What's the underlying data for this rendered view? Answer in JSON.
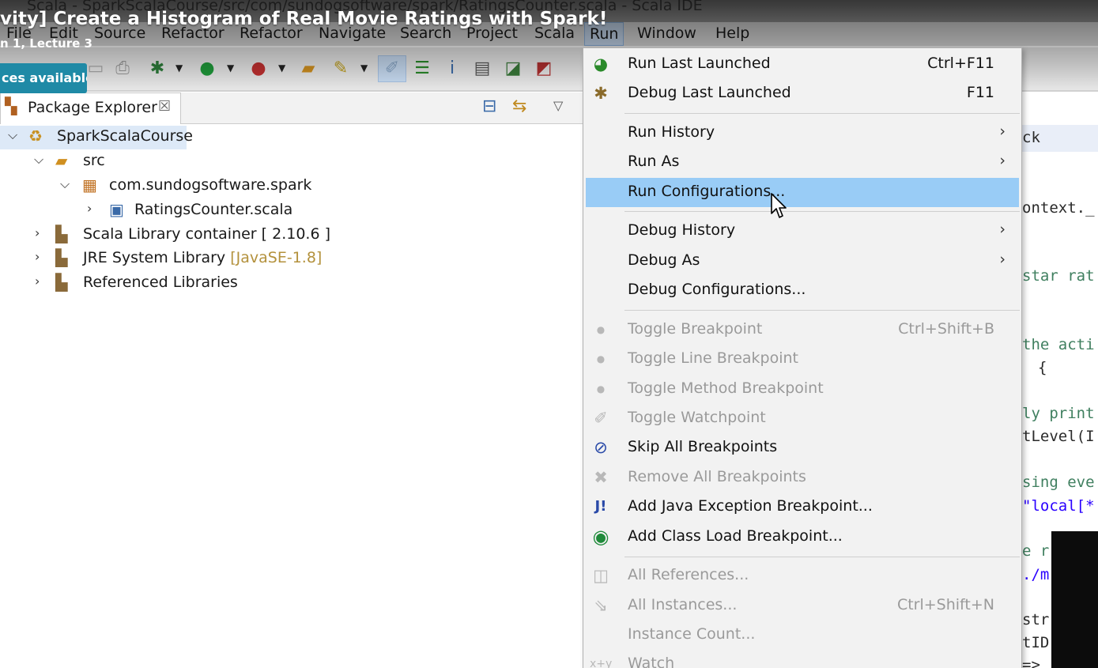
{
  "window": {
    "title": "Scala - SparkScalaCourse/src/com/sundogsoftware/spark/RatingsCounter.scala - Scala IDE"
  },
  "overlay": {
    "lecture_title": "vity] Create a Histogram of Real Movie Ratings with Spark!",
    "lecture_subtitle": "n 1, Lecture 3",
    "resources_badge": "ces available"
  },
  "menubar": {
    "items": [
      {
        "label": "File"
      },
      {
        "label": "Edit"
      },
      {
        "label": "Source"
      },
      {
        "label": "Refactor"
      },
      {
        "label": "Refactor"
      },
      {
        "label": "Navigate"
      },
      {
        "label": "Search"
      },
      {
        "label": "Project"
      },
      {
        "label": "Scala"
      },
      {
        "label": "Run",
        "active": true
      },
      {
        "label": "Window"
      },
      {
        "label": "Help"
      }
    ]
  },
  "package_explorer": {
    "tab_label": "Package Explorer",
    "tree": [
      {
        "label": "SparkScalaCourse",
        "selected": true
      },
      {
        "label": "src"
      },
      {
        "label": "com.sundogsoftware.spark"
      },
      {
        "label": "RatingsCounter.scala"
      },
      {
        "label": "Scala Library container [ 2.10.6 ]"
      },
      {
        "label": "JRE System Library",
        "suffix": "[JavaSE-1.8]"
      },
      {
        "label": "Referenced Libraries"
      }
    ]
  },
  "editor": {
    "fragments": [
      "ck",
      "ontext._",
      "star rat",
      "the acti",
      "{",
      "ly print",
      "tLevel(I",
      "sing eve",
      "\"local[*",
      "e r",
      "./m",
      "str",
      "tID",
      "=>"
    ]
  },
  "run_menu": {
    "items": [
      {
        "label": "Run Last Launched",
        "accel": "Ctrl+F11",
        "icon": "run-last-icon"
      },
      {
        "label": "Debug Last Launched",
        "accel": "F11",
        "icon": "debug-last-icon"
      },
      {
        "label": "Run History",
        "icon": "none"
      },
      {
        "label": "Run As",
        "icon": "none"
      },
      {
        "label": "Run Configurations...",
        "icon": "none",
        "highlighted": true
      },
      {
        "label": "Debug History",
        "icon": "none"
      },
      {
        "label": "Debug As",
        "icon": "none"
      },
      {
        "label": "Debug Configurations...",
        "icon": "none"
      },
      {
        "label": "Toggle Breakpoint",
        "accel": "Ctrl+Shift+B",
        "icon": "breakpoint-dot-icon",
        "disabled": true
      },
      {
        "label": "Toggle Line Breakpoint",
        "icon": "breakpoint-dot-icon",
        "disabled": true
      },
      {
        "label": "Toggle Method Breakpoint",
        "icon": "breakpoint-dot-icon",
        "disabled": true
      },
      {
        "label": "Toggle Watchpoint",
        "icon": "watchpoint-icon",
        "disabled": true
      },
      {
        "label": "Skip All Breakpoints",
        "icon": "skip-breakpoints-icon"
      },
      {
        "label": "Remove All Breakpoints",
        "icon": "remove-breakpoints-icon",
        "disabled": true
      },
      {
        "label": "Add Java Exception Breakpoint...",
        "icon": "java-exception-icon"
      },
      {
        "label": "Add Class Load Breakpoint...",
        "icon": "class-load-icon"
      },
      {
        "label": "All References...",
        "icon": "all-references-icon",
        "disabled": true
      },
      {
        "label": "All Instances...",
        "accel": "Ctrl+Shift+N",
        "icon": "all-instances-icon",
        "disabled": true
      },
      {
        "label": "Instance Count...",
        "icon": "none",
        "disabled": true
      },
      {
        "label": "Watch",
        "icon": "watch-icon",
        "disabled": true
      }
    ]
  }
}
